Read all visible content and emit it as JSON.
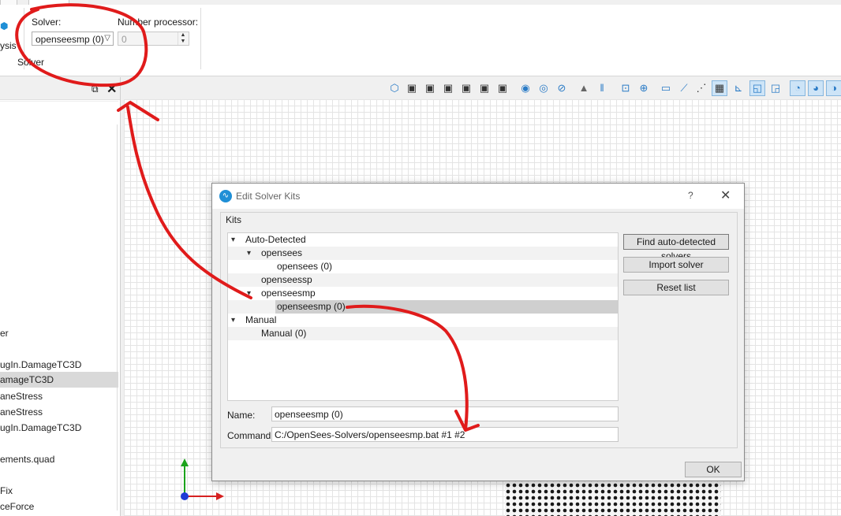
{
  "ribbon": {
    "solver_label": "Solver:",
    "solver_value": "openseesmp (0)",
    "number_processor_label": "Number processor:",
    "number_processor_value": "0",
    "group_label": "Solver",
    "analysis_label": "ysis"
  },
  "left_panel": {
    "items": [
      {
        "label": "er"
      },
      {
        "label": "ugIn.DamageTC3D"
      },
      {
        "label": "amageTC3D"
      },
      {
        "label": "aneStress"
      },
      {
        "label": "aneStress"
      },
      {
        "label": "ugIn.DamageTC3D"
      },
      {
        "label": "ements.quad"
      },
      {
        "label": "Fix"
      },
      {
        "label": "ceForce"
      }
    ]
  },
  "toolbar": {
    "icons": [
      "iso-view-icon",
      "view-front-icon",
      "view-back-icon",
      "view-left-icon",
      "view-right-icon",
      "view-top-icon",
      "view-bottom-icon",
      "show-hidden-icon",
      "visibility-icon",
      "hide-icon",
      "perspective-icon",
      "parallel-icon",
      "zoom-fit-icon",
      "zoom-icon",
      "screen-icon",
      "measure-icon",
      "grid-icon",
      "axis-icon",
      "select-icon",
      "select-mode-icon",
      "display-icon",
      "display-2-icon",
      "display-3-icon"
    ]
  },
  "dialog": {
    "title": "Edit Solver Kits",
    "help": "?",
    "close": "✕",
    "group_title": "Kits",
    "tree": [
      {
        "label": "Auto-Detected",
        "depth": 0,
        "expanded": true
      },
      {
        "label": "opensees",
        "depth": 1,
        "expanded": true
      },
      {
        "label": "opensees (0)",
        "depth": 2
      },
      {
        "label": "openseessp",
        "depth": 1
      },
      {
        "label": "openseesmp",
        "depth": 1,
        "expanded": true
      },
      {
        "label": "openseesmp (0)",
        "depth": 2,
        "selected": true
      },
      {
        "label": "Manual",
        "depth": 0,
        "expanded": true
      },
      {
        "label": "Manual (0)",
        "depth": 1
      }
    ],
    "buttons": {
      "find": "Find auto-detected solvers",
      "import": "Import solver",
      "reset": "Reset list",
      "ok": "OK"
    },
    "name_label": "Name:",
    "name_value": "openseesmp (0)",
    "command_label": "Command:",
    "command_value": "C:/OpenSees-Solvers/openseesmp.bat #1 #2"
  },
  "colors": {
    "annotation_red": "#e01b1b",
    "axis_green": "#1aa31a",
    "axis_red": "#d62020",
    "axis_blue": "#1f3bd6",
    "toolbar_blue": "#2a7bc6"
  }
}
